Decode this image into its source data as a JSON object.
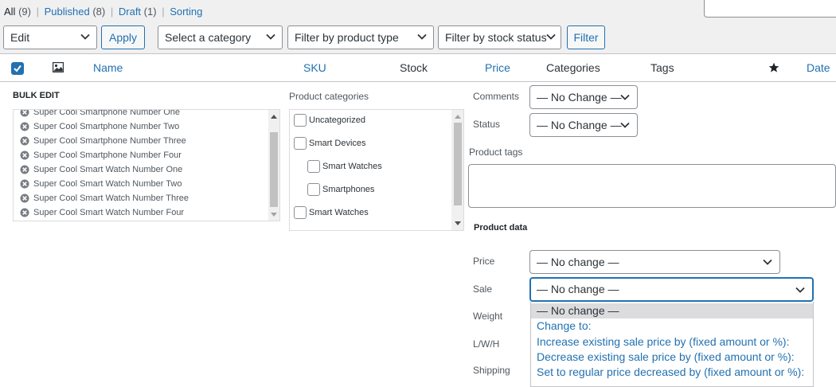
{
  "filters": {
    "all_label": "All",
    "all_count": "(9)",
    "published_label": "Published",
    "published_count": "(8)",
    "draft_label": "Draft",
    "draft_count": "(1)",
    "sorting_label": "Sorting",
    "separator": "|"
  },
  "toolbar": {
    "bulk_action_value": "Edit",
    "apply_label": "Apply",
    "category_value": "Select a category",
    "product_type_value": "Filter by product type",
    "stock_status_value": "Filter by stock status",
    "filter_label": "Filter"
  },
  "columns": {
    "name": "Name",
    "sku": "SKU",
    "stock": "Stock",
    "price": "Price",
    "categories": "Categories",
    "tags": "Tags",
    "date": "Date"
  },
  "bulk_edit": {
    "heading": "BULK EDIT",
    "titles": [
      "Super Cool Smartphone Number One",
      "Super Cool Smartphone Number Two",
      "Super Cool Smartphone Number Three",
      "Super Cool Smartphone Number Four",
      "Super Cool Smart Watch Number One",
      "Super Cool Smart Watch Number Two",
      "Super Cool Smart Watch Number Three",
      "Super Cool Smart Watch Number Four"
    ],
    "categories_label": "Product categories",
    "categories": [
      {
        "label": "Uncategorized",
        "indent": 0
      },
      {
        "label": "Smart Devices",
        "indent": 0
      },
      {
        "label": "Smart Watches",
        "indent": 1
      },
      {
        "label": "Smartphones",
        "indent": 1
      },
      {
        "label": "Smart Watches",
        "indent": 0
      }
    ],
    "comments_label": "Comments",
    "comments_value": "— No Change —",
    "status_label": "Status",
    "status_value": "— No Change —",
    "tags_label": "Product tags",
    "product_data_label": "Product data",
    "price_label": "Price",
    "price_value": "— No change —",
    "sale_label": "Sale",
    "sale_value": "— No change —",
    "weight_label": "Weight",
    "lwh_label": "L/W/H",
    "shipping_label": "Shipping",
    "sale_options": [
      "— No change —",
      "Change to:",
      "Increase existing sale price by (fixed amount or %):",
      "Decrease existing sale price by (fixed amount or %):",
      "Set to regular price decreased by (fixed amount or %):"
    ]
  },
  "colors": {
    "link": "#2271b1",
    "border": "#8c8f94",
    "selected_option": "#dcdcde"
  },
  "icons": [
    "chevron-down-icon",
    "image-icon",
    "star-icon",
    "remove-icon",
    "checkbox-checked-icon"
  ]
}
